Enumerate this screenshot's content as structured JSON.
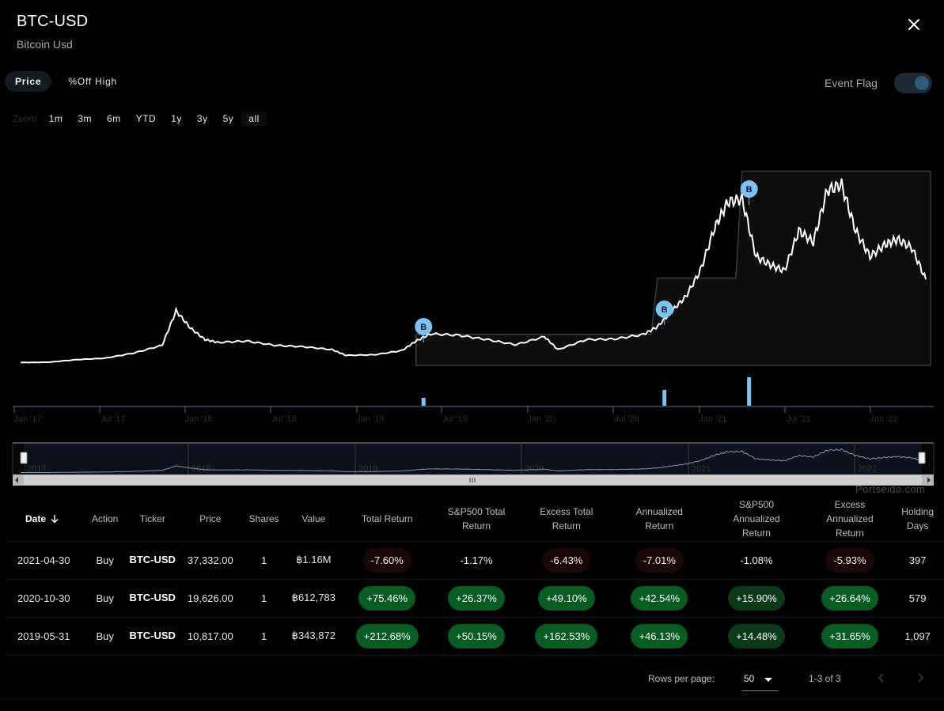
{
  "header": {
    "title": "BTC-USD",
    "subtitle": "Bitcoin Usd"
  },
  "view_toggle": [
    {
      "label": "Price",
      "active": true
    },
    {
      "label": "%Off High",
      "active": false
    }
  ],
  "event_flag": {
    "label": "Event Flag",
    "enabled": true
  },
  "zoom": {
    "label": "Zoom",
    "options": [
      "1m",
      "3m",
      "6m",
      "YTD",
      "1y",
      "3y",
      "5y",
      "all"
    ],
    "selected": "all"
  },
  "watermark": "Portseido.com",
  "chart_data": {
    "type": "line",
    "x_tick_labels": [
      "Jan '17",
      "Jul '17",
      "Jan '18",
      "Jul '18",
      "Jan '19",
      "Jul '19",
      "Jan '20",
      "Jul '20",
      "Jan '21",
      "Jul '21",
      "Jan '22"
    ],
    "navigator_labels": [
      "2017",
      "2018",
      "2019",
      "2020",
      "2021",
      "2022"
    ],
    "series": [
      {
        "name": "Price",
        "color": "#ffffff",
        "x": [
          "2017-01",
          "2017-03",
          "2017-05",
          "2017-07",
          "2017-09",
          "2017-11",
          "2017-12",
          "2018-01",
          "2018-02",
          "2018-03",
          "2018-05",
          "2018-07",
          "2018-09",
          "2018-11",
          "2018-12",
          "2019-02",
          "2019-04",
          "2019-05",
          "2019-06",
          "2019-08",
          "2019-10",
          "2019-12",
          "2020-02",
          "2020-03",
          "2020-05",
          "2020-07",
          "2020-09",
          "2020-10",
          "2020-11",
          "2020-12",
          "2021-01",
          "2021-02",
          "2021-03",
          "2021-04",
          "2021-05",
          "2021-06",
          "2021-07",
          "2021-08",
          "2021-09",
          "2021-10",
          "2021-11",
          "2021-12",
          "2022-01",
          "2022-02",
          "2022-03",
          "2022-04",
          "2022-05"
        ],
        "y": [
          1000,
          1100,
          2000,
          2500,
          4300,
          7000,
          19000,
          13000,
          9000,
          8000,
          8500,
          7000,
          6500,
          5500,
          3500,
          3700,
          5200,
          8500,
          11000,
          10500,
          9000,
          7200,
          10000,
          5500,
          9000,
          9200,
          10800,
          13500,
          19000,
          24000,
          33000,
          48000,
          57000,
          58000,
          38000,
          35000,
          33000,
          47000,
          43000,
          61000,
          63000,
          47000,
          38000,
          42000,
          44000,
          41000,
          30000
        ]
      },
      {
        "name": "Cost basis",
        "color": "#3a3a3a",
        "x": [
          "2019-05",
          "2020-10",
          "2021-04",
          "2022-05"
        ],
        "y": [
          10817,
          30443,
          67775,
          67775
        ]
      }
    ],
    "flags": [
      {
        "label": "B",
        "date": "2019-05-31"
      },
      {
        "label": "B",
        "date": "2020-10-30"
      },
      {
        "label": "B",
        "date": "2021-04-30"
      }
    ],
    "volume": [
      {
        "date": "2019-05-31",
        "value": 1
      },
      {
        "date": "2020-10-30",
        "value": 1
      },
      {
        "date": "2021-04-30",
        "value": 1
      }
    ]
  },
  "table": {
    "columns": [
      "Date",
      "Action",
      "Ticker",
      "Price",
      "Shares",
      "Value",
      "Total Return",
      "S&P500 Total Return",
      "Excess Total Return",
      "Annualized Return",
      "S&P500 Annualized Return",
      "Excess Annualized Return",
      "Holding Days"
    ],
    "sort_icon": "arrow-down-icon",
    "rows": [
      {
        "date": "2021-04-30",
        "action": "Buy",
        "ticker": "BTC-USD",
        "price": "37,332.00",
        "shares": "1",
        "value": "฿1.16M",
        "total_return": "-7.60%",
        "sp_total": "-1.17%",
        "excess_total": "-6.43%",
        "annualized": "-7.01%",
        "sp_annualized": "-1.08%",
        "excess_annualized": "-5.93%",
        "holding_days": "397"
      },
      {
        "date": "2020-10-30",
        "action": "Buy",
        "ticker": "BTC-USD",
        "price": "19,626.00",
        "shares": "1",
        "value": "฿612,783",
        "total_return": "+75.46%",
        "sp_total": "+26.37%",
        "excess_total": "+49.10%",
        "annualized": "+42.54%",
        "sp_annualized": "+15.90%",
        "excess_annualized": "+26.64%",
        "holding_days": "579"
      },
      {
        "date": "2019-05-31",
        "action": "Buy",
        "ticker": "BTC-USD",
        "price": "10,817.00",
        "shares": "1",
        "value": "฿343,872",
        "total_return": "+212.68%",
        "sp_total": "+50.15%",
        "excess_total": "+162.53%",
        "annualized": "+46.13%",
        "sp_annualized": "+14.48%",
        "excess_annualized": "+31.65%",
        "holding_days": "1,097"
      }
    ]
  },
  "pagination": {
    "rows_per_page_label": "Rows per page:",
    "rows_per_page": "50",
    "range": "1-3 of 3"
  },
  "colors": {
    "background": "#000000",
    "positive_pill": "#075c22",
    "negative_pill": "#1a0808",
    "flag": "#7cc3f5",
    "volume_bar": "#7cc3f5"
  }
}
